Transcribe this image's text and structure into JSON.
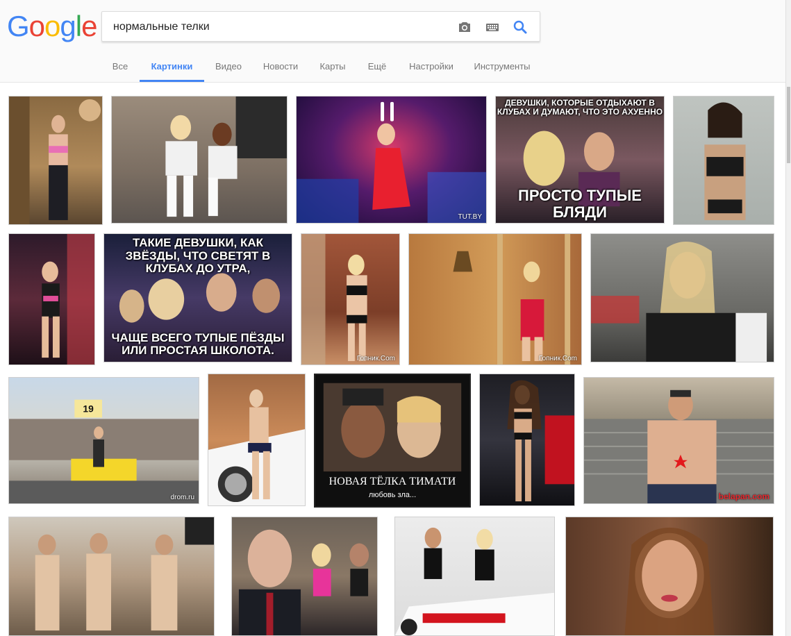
{
  "logo": {
    "letters": [
      "G",
      "o",
      "o",
      "g",
      "l",
      "e"
    ],
    "colors": [
      "#4285f4",
      "#ea4335",
      "#fbbc05",
      "#4285f4",
      "#34a853",
      "#ea4335"
    ]
  },
  "search": {
    "value": "нормальные телки",
    "icons": [
      "camera-icon",
      "keyboard-icon",
      "search-icon"
    ]
  },
  "tabs": [
    {
      "label": "Все",
      "active": false
    },
    {
      "label": "Картинки",
      "active": true
    },
    {
      "label": "Видео",
      "active": false
    },
    {
      "label": "Новости",
      "active": false
    },
    {
      "label": "Карты",
      "active": false
    },
    {
      "label": "Ещё",
      "active": false
    },
    {
      "label": "Настройки",
      "active": false
    },
    {
      "label": "Инструменты",
      "active": false
    }
  ],
  "results": [
    {
      "caption": "",
      "watermark": ""
    },
    {
      "caption": "",
      "watermark": ""
    },
    {
      "caption": "",
      "watermark": "TUT.BY"
    },
    {
      "caption_top": "ДЕВУШКИ, КОТОРЫЕ ОТДЫХАЮТ В КЛУБАХ И ДУМАЮТ, ЧТО ЭТО АХУЕННО",
      "caption_bottom": "ПРОСТО ТУПЫЕ БЛЯДИ"
    },
    {
      "caption": "",
      "watermark": ""
    },
    {
      "caption": "",
      "watermark": ""
    },
    {
      "caption_top": "ТАКИЕ ДЕВУШКИ, КАК ЗВЁЗДЫ, ЧТО СВЕТЯТ В КЛУБАХ ДО УТРА,",
      "caption_bottom": "ЧАЩЕ ВСЕГО ТУПЫЕ ПЁЗДЫ ИЛИ ПРОСТАЯ ШКОЛОТА."
    },
    {
      "caption": "",
      "watermark": "Гопник.Com"
    },
    {
      "caption": "",
      "watermark": "Гопник.Com"
    },
    {
      "caption": "",
      "watermark": ""
    },
    {
      "caption": "",
      "watermark": "drom.ru",
      "badge": "19"
    },
    {
      "caption": "",
      "watermark": ""
    },
    {
      "caption_top": "",
      "caption_bottom": "НОВАЯ ТЁЛКА ТИМАТИ",
      "subcaption": "любовь зла..."
    },
    {
      "caption": "",
      "watermark": ""
    },
    {
      "caption": "",
      "watermark": "belapan.com"
    },
    {
      "caption": "",
      "watermark": ""
    },
    {
      "caption": "",
      "watermark": ""
    },
    {
      "caption": "",
      "watermark": ""
    },
    {
      "caption": "",
      "watermark": ""
    }
  ],
  "colors": {
    "accent": "#4285f4",
    "tab_text": "#777777",
    "header_bg": "#fafafa"
  }
}
